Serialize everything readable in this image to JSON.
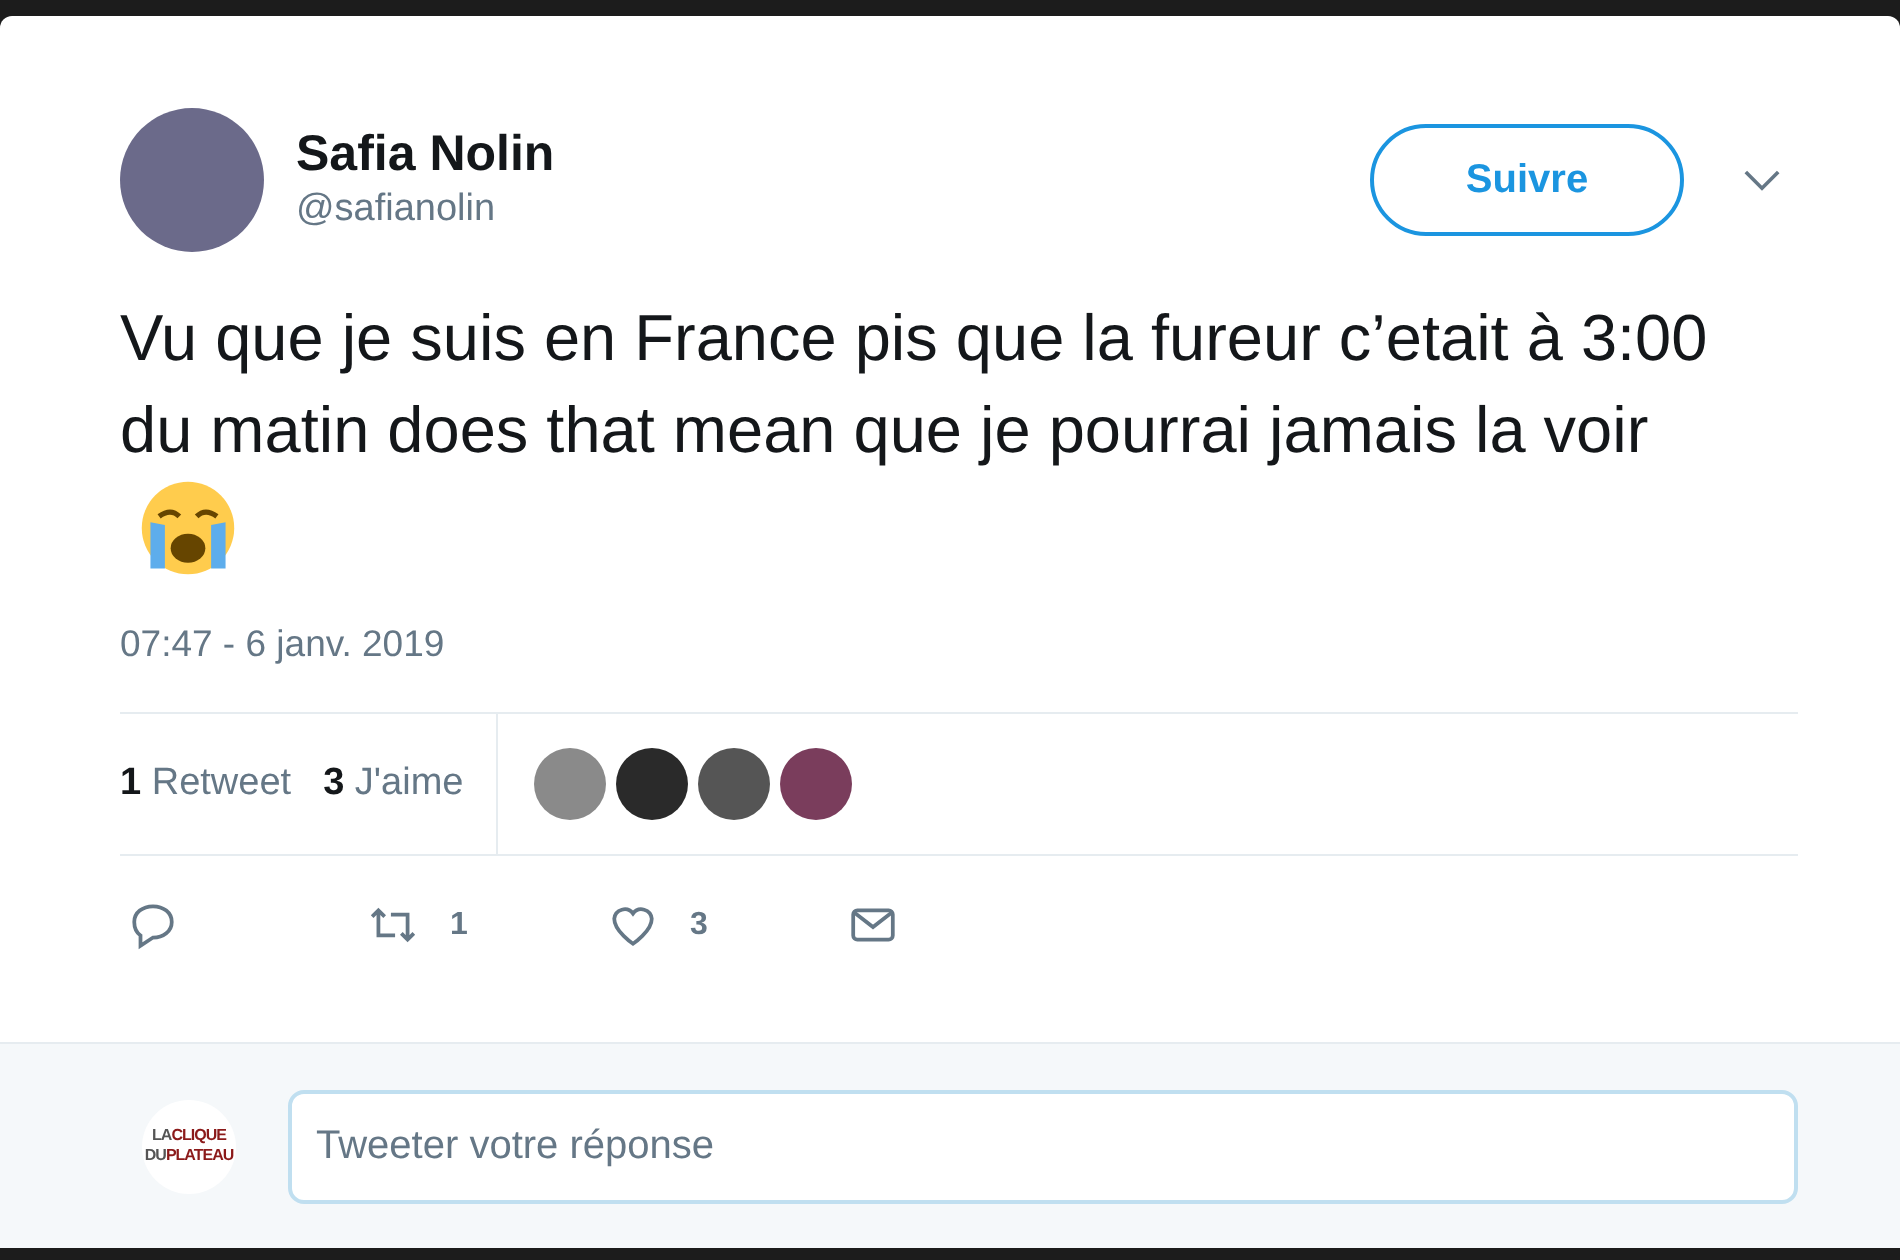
{
  "author": {
    "name": "Safia Nolin",
    "handle": "@safianolin"
  },
  "follow_button": "Suivre",
  "tweet": {
    "text": "Vu que je suis en France pis que la fureur c’etait à 3:00 du matin does that mean que je pourrai jamais la voir",
    "timestamp": "07:47 - 6 janv. 2019"
  },
  "stats": [
    {
      "count": "1",
      "label": "Retweet"
    },
    {
      "count": "3",
      "label": "J'aime"
    }
  ],
  "likers": [
    {
      "color": "#8a8a8a"
    },
    {
      "color": "#2a2a2a"
    },
    {
      "color": "#555555"
    },
    {
      "color": "#7a3d5c"
    }
  ],
  "actions": [
    {
      "kind": "reply"
    },
    {
      "kind": "retweet",
      "count": "1"
    },
    {
      "kind": "like",
      "count": "3"
    },
    {
      "kind": "message"
    }
  ],
  "reply": {
    "logo_lines": [
      [
        "LA",
        "CLIQUE"
      ],
      [
        "DU",
        "PLATEAU"
      ]
    ],
    "placeholder": "Tweeter votre réponse"
  }
}
